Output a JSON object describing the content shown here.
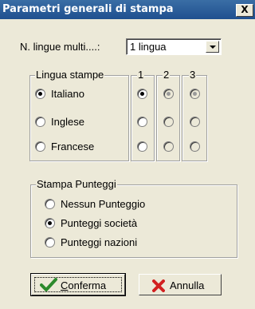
{
  "window": {
    "title": "Parametri generali di stampa",
    "close_symbol": "X",
    "close_icon": "close-icon"
  },
  "lingue_multi": {
    "label": "N. lingue multi....:",
    "selected_value": "1 lingua"
  },
  "lingua_stampe": {
    "group_title": "Lingua stampe",
    "options": [
      "Italiano",
      "Inglese",
      "Francese"
    ],
    "selected_index": 0,
    "columns": [
      {
        "title": "1",
        "enabled": true,
        "selected_index": 0
      },
      {
        "title": "2",
        "enabled": false,
        "selected_index": 0
      },
      {
        "title": "3",
        "enabled": false,
        "selected_index": 0
      }
    ]
  },
  "stampa_punteggi": {
    "group_title": "Stampa Punteggi",
    "options": [
      "Nessun Punteggio",
      "Punteggi società",
      "Punteggi nazioni"
    ],
    "selected_index": 1
  },
  "buttons": {
    "confirm_first_letter": "C",
    "confirm_rest": "onferma",
    "confirm_icon": "checkmark-icon",
    "cancel_label": "Annulla",
    "cancel_icon": "red-x-icon",
    "confirm_icon_color": "#2c8a2c",
    "cancel_icon_color": "#d22020"
  }
}
